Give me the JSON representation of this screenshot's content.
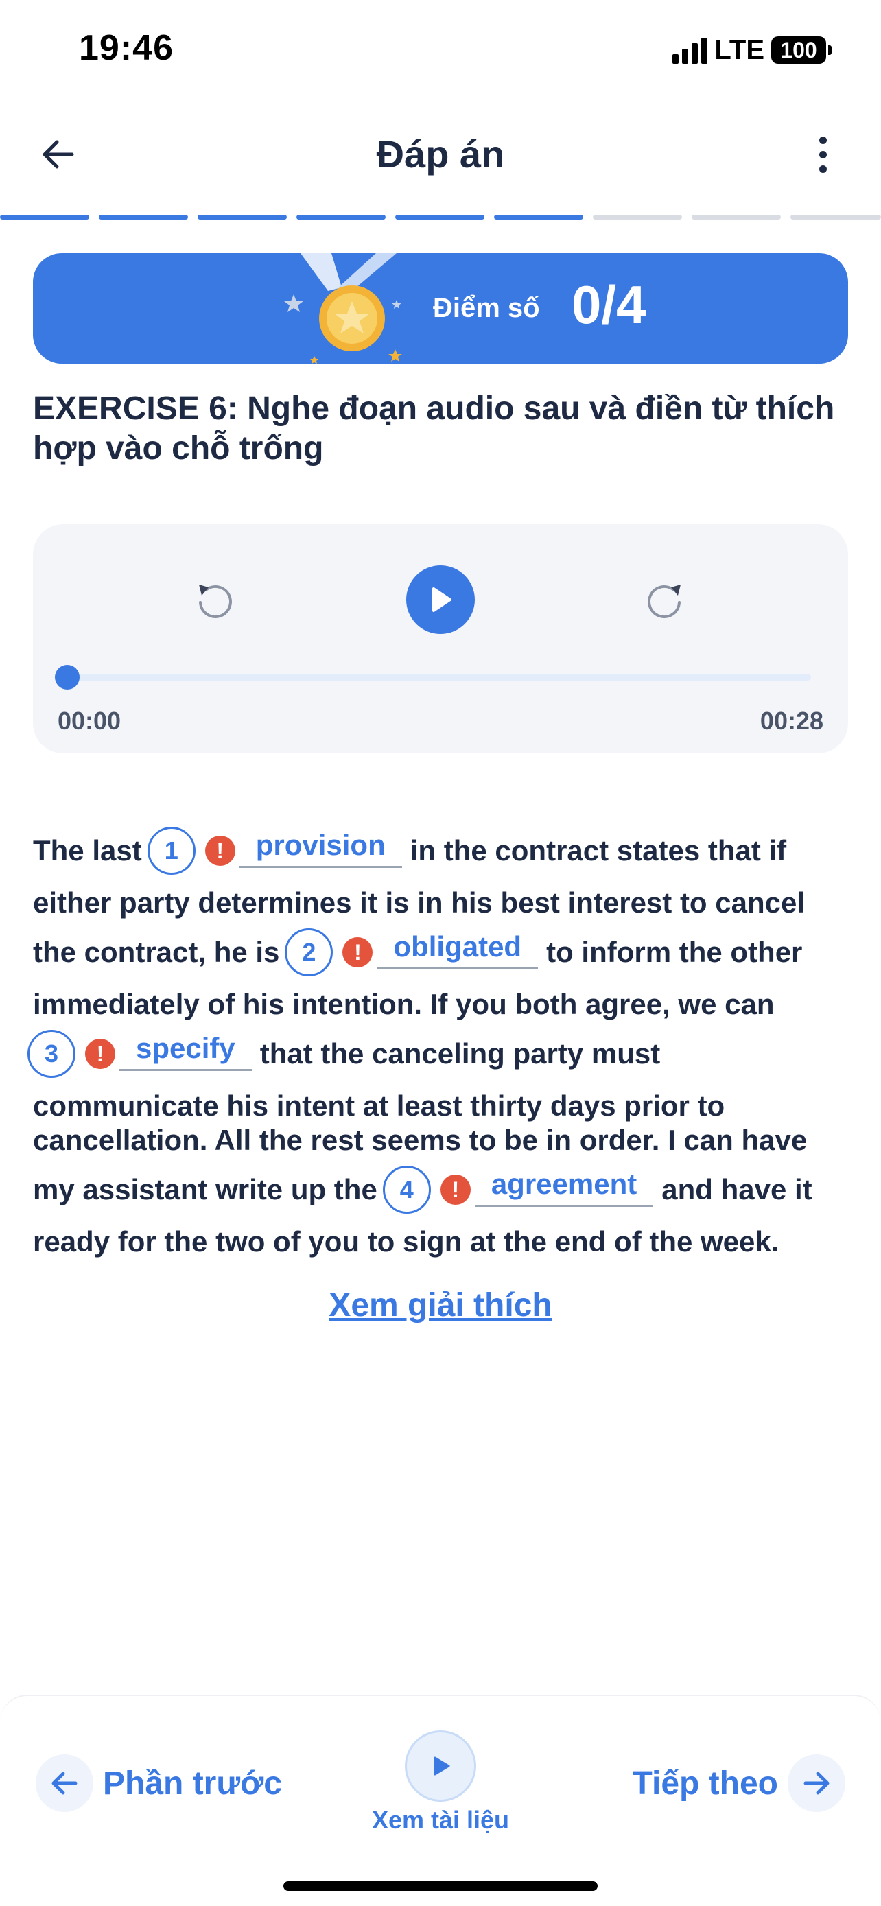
{
  "status_bar": {
    "time": "19:46",
    "network": "LTE",
    "battery": "100"
  },
  "header": {
    "title": "Đáp án",
    "back_icon": "arrow-left-icon",
    "more_icon": "more-vertical-icon"
  },
  "progress": {
    "total_segments": 9,
    "completed_segments": 6,
    "active_color": "#3a78e2",
    "inactive_color": "#d9dde3"
  },
  "score": {
    "label": "Điểm số",
    "value": "0/4"
  },
  "exercise": {
    "title": "EXERCISE 6: Nghe đoạn audio sau và điền từ thích hợp vào chỗ trống"
  },
  "player": {
    "current_time": "00:00",
    "total_time": "00:28",
    "progress": 0
  },
  "passage": {
    "line1_a": "The last",
    "line1_b": "in the contract states that if",
    "line2": "either party determines it is in his best interest to cancel",
    "line3_a": "the contract, he is",
    "line3_b": "to inform the other",
    "line4": "immediately of his intention. If you both agree, we can",
    "line5_b": "that the canceling party must",
    "line6": "communicate his intent at least thirty days prior to",
    "line7": "cancellation. All the rest seems to be in order. I can have",
    "line8_a": "my assistant write up the",
    "line8_b": "and have it",
    "line9": "ready for the two of you to sign at the end of the week.",
    "blanks": [
      {
        "number": "1",
        "answer": "provision",
        "status": "!"
      },
      {
        "number": "2",
        "answer": "obligated",
        "status": "!"
      },
      {
        "number": "3",
        "answer": "specify",
        "status": "!"
      },
      {
        "number": "4",
        "answer": "agreement",
        "status": "!"
      }
    ]
  },
  "explain_link": "Xem giải thích",
  "bottom": {
    "prev_label": "Phần trước",
    "doc_label": "Xem tài liệu",
    "next_label": "Tiếp theo"
  },
  "colors": {
    "accent": "#3a78e2",
    "warning": "#e4533b",
    "text": "#1e2a44"
  }
}
